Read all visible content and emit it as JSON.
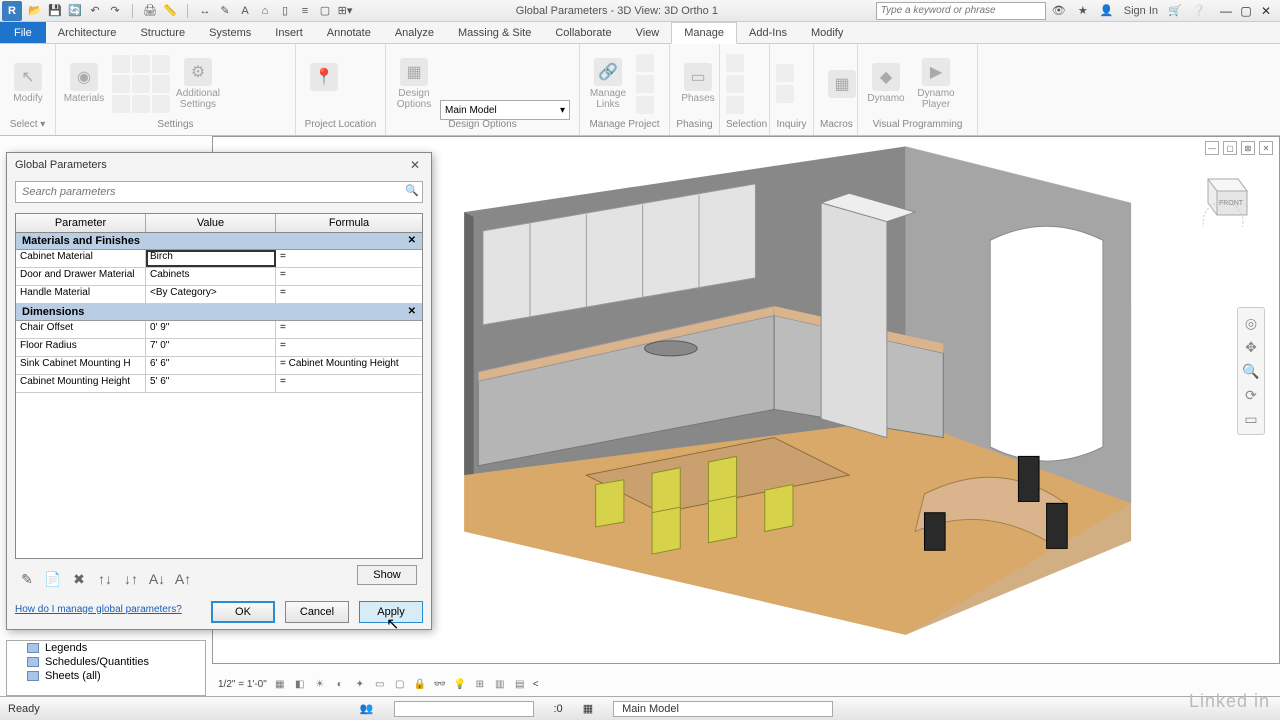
{
  "titlebar": {
    "title": "Global Parameters - 3D View: 3D Ortho 1",
    "search_placeholder": "Type a keyword or phrase",
    "signin": "Sign In"
  },
  "ribbon_tabs": [
    "Architecture",
    "Structure",
    "Systems",
    "Insert",
    "Annotate",
    "Analyze",
    "Massing & Site",
    "Collaborate",
    "View",
    "Manage",
    "Add-Ins",
    "Modify"
  ],
  "file_tab": "File",
  "ribbon": {
    "select": "Select ▾",
    "modify": "Modify",
    "materials": "Materials",
    "settings_group": "Settings",
    "additional_settings": "Additional\nSettings",
    "project_location": "Project Location",
    "design_options": "Design Options",
    "design_options_btn": "Design\nOptions",
    "design_dropdown": "Main Model",
    "manage_project": "Manage Project",
    "manage_links": "Manage\nLinks",
    "phasing": "Phasing",
    "phases_btn": "Phases",
    "selection": "Selection",
    "inquiry": "Inquiry",
    "macros": "Macros",
    "visual_programming": "Visual Programming",
    "dynamo": "Dynamo",
    "dynamo_player": "Dynamo\nPlayer"
  },
  "dialog": {
    "title": "Global Parameters",
    "search_placeholder": "Search parameters",
    "headers": {
      "param": "Parameter",
      "value": "Value",
      "formula": "Formula"
    },
    "group1": "Materials and Finishes",
    "group2": "Dimensions",
    "rows_g1": [
      {
        "p": "Cabinet Material",
        "v": "Birch",
        "f": "="
      },
      {
        "p": "Door and Drawer Material",
        "v": "Cabinets",
        "f": "="
      },
      {
        "p": "Handle Material",
        "v": "<By Category>",
        "f": "="
      }
    ],
    "rows_g2": [
      {
        "p": "Chair Offset",
        "v": "0'  9\"",
        "f": "="
      },
      {
        "p": "Floor Radius",
        "v": "7'  0\"",
        "f": "="
      },
      {
        "p": "Sink Cabinet Mounting H",
        "v": "6'  6\"",
        "f": "= Cabinet Mounting Height"
      },
      {
        "p": "Cabinet Mounting Height",
        "v": "5'  6\"",
        "f": "="
      }
    ],
    "show": "Show",
    "help_link": "How do I manage global parameters?",
    "ok": "OK",
    "cancel": "Cancel",
    "apply": "Apply"
  },
  "browser": {
    "legends": "Legends",
    "schedules": "Schedules/Quantities",
    "sheets": "Sheets (all)"
  },
  "vcb": {
    "scale": "1/2\" = 1'-0\""
  },
  "statusbar": {
    "ready": "Ready",
    "zero": ":0",
    "model": "Main Model"
  },
  "viewcube": "FRONT",
  "watermark": "Linked in"
}
